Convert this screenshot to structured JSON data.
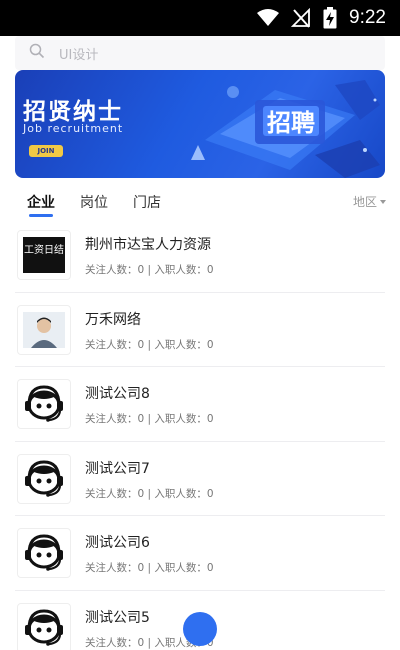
{
  "status_bar": {
    "time": "9:22"
  },
  "search": {
    "placeholder": "UI设计"
  },
  "banner": {
    "title": "招贤纳士",
    "subtitle": "Job recruitment",
    "button": "JOIN",
    "art_text": "招聘"
  },
  "tabs": {
    "items": [
      {
        "label": "企业",
        "active": true
      },
      {
        "label": "岗位",
        "active": false
      },
      {
        "label": "门店",
        "active": false
      }
    ],
    "region_label": "地区"
  },
  "companies": [
    {
      "name": "荆州市达宝人力资源",
      "stats": "关注人数：0 | 入职人数：0",
      "logo": "工资日结"
    },
    {
      "name": "万禾网络",
      "stats": "关注人数：0 | 入职人数：0",
      "logo": "avatar-photo"
    },
    {
      "name": "测试公司8",
      "stats": "关注人数：0 | 入职人数：0",
      "logo": "headset-face-icon"
    },
    {
      "name": "测试公司7",
      "stats": "关注人数：0 | 入职人数：0",
      "logo": "headset-face-icon"
    },
    {
      "name": "测试公司6",
      "stats": "关注人数：0 | 入职人数：0",
      "logo": "headset-face-icon"
    },
    {
      "name": "测试公司5",
      "stats": "关注人数：0 | 入职人数：0",
      "logo": "headset-face-icon"
    }
  ],
  "colors": {
    "accent": "#2f6ff0",
    "banner_blue": "#1f5be0",
    "join_yellow": "#f1c945"
  }
}
